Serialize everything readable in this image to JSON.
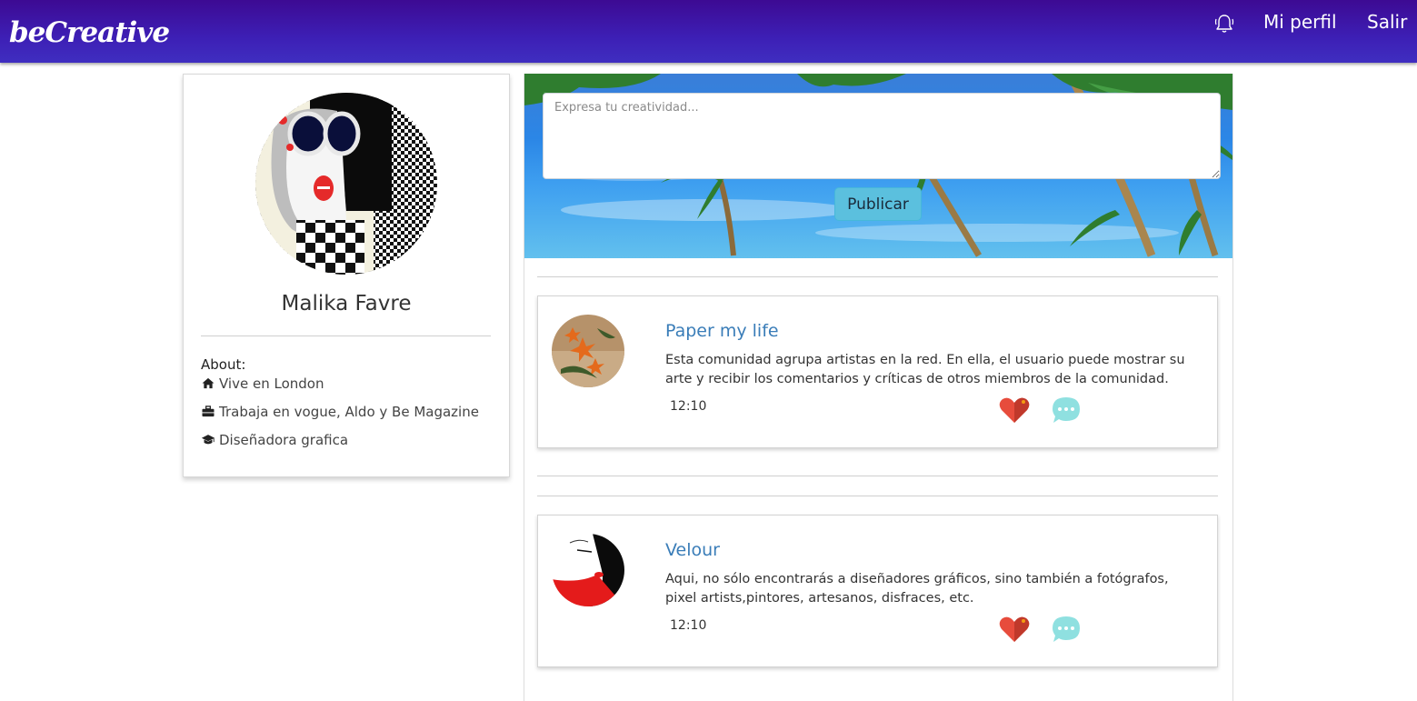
{
  "navbar": {
    "brand": "beCreative",
    "notification_icon": "bell-icon",
    "profile_label": "Mi perfil",
    "logout_label": "Salir"
  },
  "profile": {
    "name": "Malika Favre",
    "about_title": "About:",
    "about_items": [
      {
        "icon": "home-icon",
        "text": "Vive en London"
      },
      {
        "icon": "briefcase-icon",
        "text": "Trabaja en vogue, Aldo y Be Magazine"
      },
      {
        "icon": "graduation-cap-icon",
        "text": "Diseñadora grafica"
      }
    ]
  },
  "composer": {
    "placeholder": "Expresa tu creatividad...",
    "publish_label": "Publicar"
  },
  "posts": [
    {
      "title": "Paper my life",
      "body": "Esta comunidad agrupa artistas en la red. En ella, el usuario puede mostrar su arte y recibir los comentarios y críticas de otros miembros de la comunidad.",
      "time": "12:10"
    },
    {
      "title": "Velour",
      "body": "Aqui, no sólo encontrarás a diseñadores gráficos, sino también a fotógrafos, pixel artists,pintores, artesanos, disfraces, etc.",
      "time": "12:10"
    }
  ],
  "colors": {
    "navbar": "#3d1fb5",
    "link": "#3a7db8",
    "publish_button": "#5bc0de",
    "like": "#e74c3c",
    "comment": "#8fe0e0"
  }
}
